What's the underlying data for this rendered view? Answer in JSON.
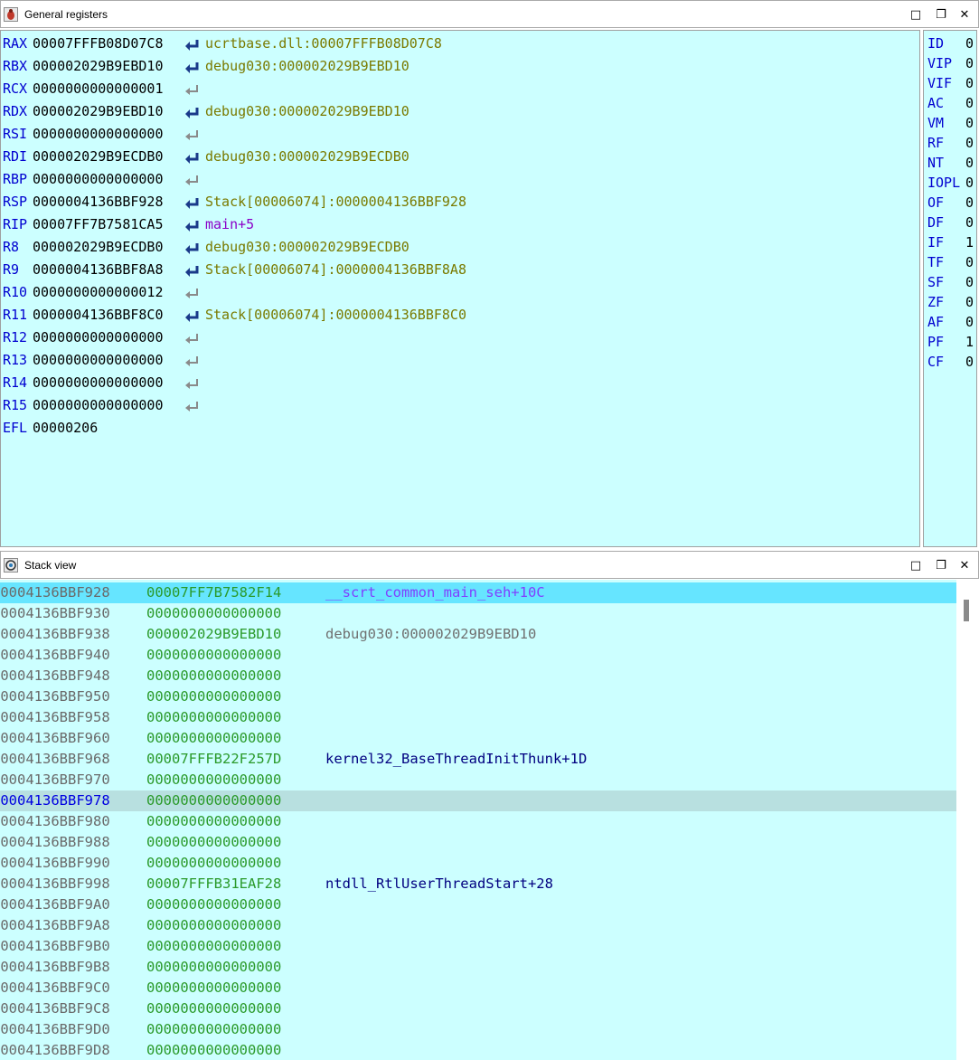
{
  "registers_window": {
    "title": "General registers",
    "registers": [
      {
        "name": "RAX",
        "value": "00007FFFB08D07C8",
        "ref": "ucrtbase.dll:00007FFFB08D07C8",
        "kind": "data"
      },
      {
        "name": "RBX",
        "value": "000002029B9EBD10",
        "ref": "debug030:000002029B9EBD10",
        "kind": "data"
      },
      {
        "name": "RCX",
        "value": "0000000000000001",
        "ref": "",
        "kind": "none"
      },
      {
        "name": "RDX",
        "value": "000002029B9EBD10",
        "ref": "debug030:000002029B9EBD10",
        "kind": "data"
      },
      {
        "name": "RSI",
        "value": "0000000000000000",
        "ref": "",
        "kind": "none"
      },
      {
        "name": "RDI",
        "value": "000002029B9ECDB0",
        "ref": "debug030:000002029B9ECDB0",
        "kind": "data"
      },
      {
        "name": "RBP",
        "value": "0000000000000000",
        "ref": "",
        "kind": "none"
      },
      {
        "name": "RSP",
        "value": "0000004136BBF928",
        "ref": "Stack[00006074]:0000004136BBF928",
        "kind": "data"
      },
      {
        "name": "RIP",
        "value": "00007FF7B7581CA5",
        "ref": "main+5",
        "kind": "code"
      },
      {
        "name": "R8",
        "value": "000002029B9ECDB0",
        "ref": "debug030:000002029B9ECDB0",
        "kind": "data"
      },
      {
        "name": "R9",
        "value": "0000004136BBF8A8",
        "ref": "Stack[00006074]:0000004136BBF8A8",
        "kind": "data"
      },
      {
        "name": "R10",
        "value": "0000000000000012",
        "ref": "",
        "kind": "none"
      },
      {
        "name": "R11",
        "value": "0000004136BBF8C0",
        "ref": "Stack[00006074]:0000004136BBF8C0",
        "kind": "data"
      },
      {
        "name": "R12",
        "value": "0000000000000000",
        "ref": "",
        "kind": "none"
      },
      {
        "name": "R13",
        "value": "0000000000000000",
        "ref": "",
        "kind": "none"
      },
      {
        "name": "R14",
        "value": "0000000000000000",
        "ref": "",
        "kind": "none"
      },
      {
        "name": "R15",
        "value": "0000000000000000",
        "ref": "",
        "kind": "none"
      },
      {
        "name": "EFL",
        "value": "00000206",
        "ref": "",
        "kind": "noarrow"
      }
    ],
    "flags": [
      {
        "name": "ID",
        "value": "0"
      },
      {
        "name": "VIP",
        "value": "0"
      },
      {
        "name": "VIF",
        "value": "0"
      },
      {
        "name": "AC",
        "value": "0"
      },
      {
        "name": "VM",
        "value": "0"
      },
      {
        "name": "RF",
        "value": "0"
      },
      {
        "name": "NT",
        "value": "0"
      },
      {
        "name": "IOPL",
        "value": "0"
      },
      {
        "name": "OF",
        "value": "0"
      },
      {
        "name": "DF",
        "value": "0"
      },
      {
        "name": "IF",
        "value": "1"
      },
      {
        "name": "TF",
        "value": "0"
      },
      {
        "name": "SF",
        "value": "0"
      },
      {
        "name": "ZF",
        "value": "0"
      },
      {
        "name": "AF",
        "value": "0"
      },
      {
        "name": "PF",
        "value": "1"
      },
      {
        "name": "CF",
        "value": "0"
      }
    ]
  },
  "stack_window": {
    "title": "Stack view",
    "rows": [
      {
        "addr": "00004136BBF928",
        "value": "00007FF7B7582F14",
        "comment": "__scrt_common_main_seh+10C",
        "ckind": "code",
        "hl": "current"
      },
      {
        "addr": "00004136BBF930",
        "value": "0000000000000000",
        "comment": "",
        "ckind": "",
        "hl": ""
      },
      {
        "addr": "00004136BBF938",
        "value": "000002029B9EBD10",
        "comment": "debug030:000002029B9EBD10",
        "ckind": "data",
        "hl": ""
      },
      {
        "addr": "00004136BBF940",
        "value": "0000000000000000",
        "comment": "",
        "ckind": "",
        "hl": ""
      },
      {
        "addr": "00004136BBF948",
        "value": "0000000000000000",
        "comment": "",
        "ckind": "",
        "hl": ""
      },
      {
        "addr": "00004136BBF950",
        "value": "0000000000000000",
        "comment": "",
        "ckind": "",
        "hl": ""
      },
      {
        "addr": "00004136BBF958",
        "value": "0000000000000000",
        "comment": "",
        "ckind": "",
        "hl": ""
      },
      {
        "addr": "00004136BBF960",
        "value": "0000000000000000",
        "comment": "",
        "ckind": "",
        "hl": ""
      },
      {
        "addr": "00004136BBF968",
        "value": "00007FFFB22F257D",
        "comment": "kernel32_BaseThreadInitThunk+1D",
        "ckind": "api",
        "hl": ""
      },
      {
        "addr": "00004136BBF970",
        "value": "0000000000000000",
        "comment": "",
        "ckind": "",
        "hl": ""
      },
      {
        "addr": "00004136BBF978",
        "value": "0000000000000000",
        "comment": "",
        "ckind": "",
        "hl": "cursor"
      },
      {
        "addr": "00004136BBF980",
        "value": "0000000000000000",
        "comment": "",
        "ckind": "",
        "hl": ""
      },
      {
        "addr": "00004136BBF988",
        "value": "0000000000000000",
        "comment": "",
        "ckind": "",
        "hl": ""
      },
      {
        "addr": "00004136BBF990",
        "value": "0000000000000000",
        "comment": "",
        "ckind": "",
        "hl": ""
      },
      {
        "addr": "00004136BBF998",
        "value": "00007FFFB31EAF28",
        "comment": "ntdll_RtlUserThreadStart+28",
        "ckind": "api",
        "hl": ""
      },
      {
        "addr": "00004136BBF9A0",
        "value": "0000000000000000",
        "comment": "",
        "ckind": "",
        "hl": ""
      },
      {
        "addr": "00004136BBF9A8",
        "value": "0000000000000000",
        "comment": "",
        "ckind": "",
        "hl": ""
      },
      {
        "addr": "00004136BBF9B0",
        "value": "0000000000000000",
        "comment": "",
        "ckind": "",
        "hl": ""
      },
      {
        "addr": "00004136BBF9B8",
        "value": "0000000000000000",
        "comment": "",
        "ckind": "",
        "hl": ""
      },
      {
        "addr": "00004136BBF9C0",
        "value": "0000000000000000",
        "comment": "",
        "ckind": "",
        "hl": ""
      },
      {
        "addr": "00004136BBF9C8",
        "value": "0000000000000000",
        "comment": "",
        "ckind": "",
        "hl": ""
      },
      {
        "addr": "00004136BBF9D0",
        "value": "0000000000000000",
        "comment": "",
        "ckind": "",
        "hl": ""
      },
      {
        "addr": "00004136BBF9D8",
        "value": "0000000000000000",
        "comment": "",
        "ckind": "",
        "hl": ""
      }
    ]
  },
  "window_buttons": {
    "maximize": "□",
    "restore": "❐",
    "close": "✕"
  },
  "colors": {
    "panel_bg": "#ccffff",
    "register_name": "#0000d0",
    "data_ref": "#7a7a00",
    "code_ref": "#8b00c8",
    "stack_value": "#2a9a2a",
    "current_row": "#66e5ff",
    "cursor_row": "#b8e0e0"
  }
}
